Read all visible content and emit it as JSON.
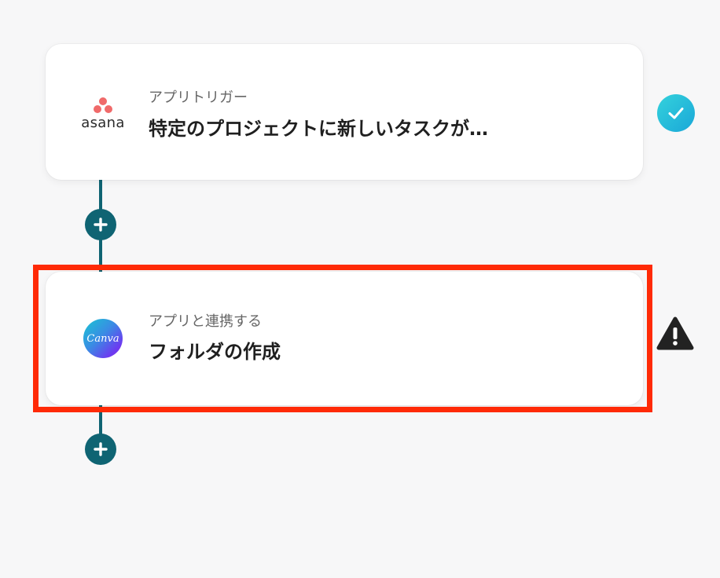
{
  "flow": {
    "steps": [
      {
        "app_name": "asana",
        "app_icon": "asana-logo-icon",
        "label": "アプリトリガー",
        "title": "特定のプロジェクトに新しいタスクが…",
        "status": "complete",
        "status_icon": "check-circle-icon"
      },
      {
        "app_name": "Canva",
        "app_icon": "canva-logo-icon",
        "label": "アプリと連携する",
        "title": "フォルダの作成",
        "status": "warning",
        "status_icon": "warning-triangle-icon"
      }
    ],
    "add_step_icon": "plus-icon"
  },
  "colors": {
    "background": "#f7f7f8",
    "connector": "#0f6473",
    "check": "#1fb8d8",
    "highlight": "#ff2a06",
    "warning": "#222222"
  }
}
